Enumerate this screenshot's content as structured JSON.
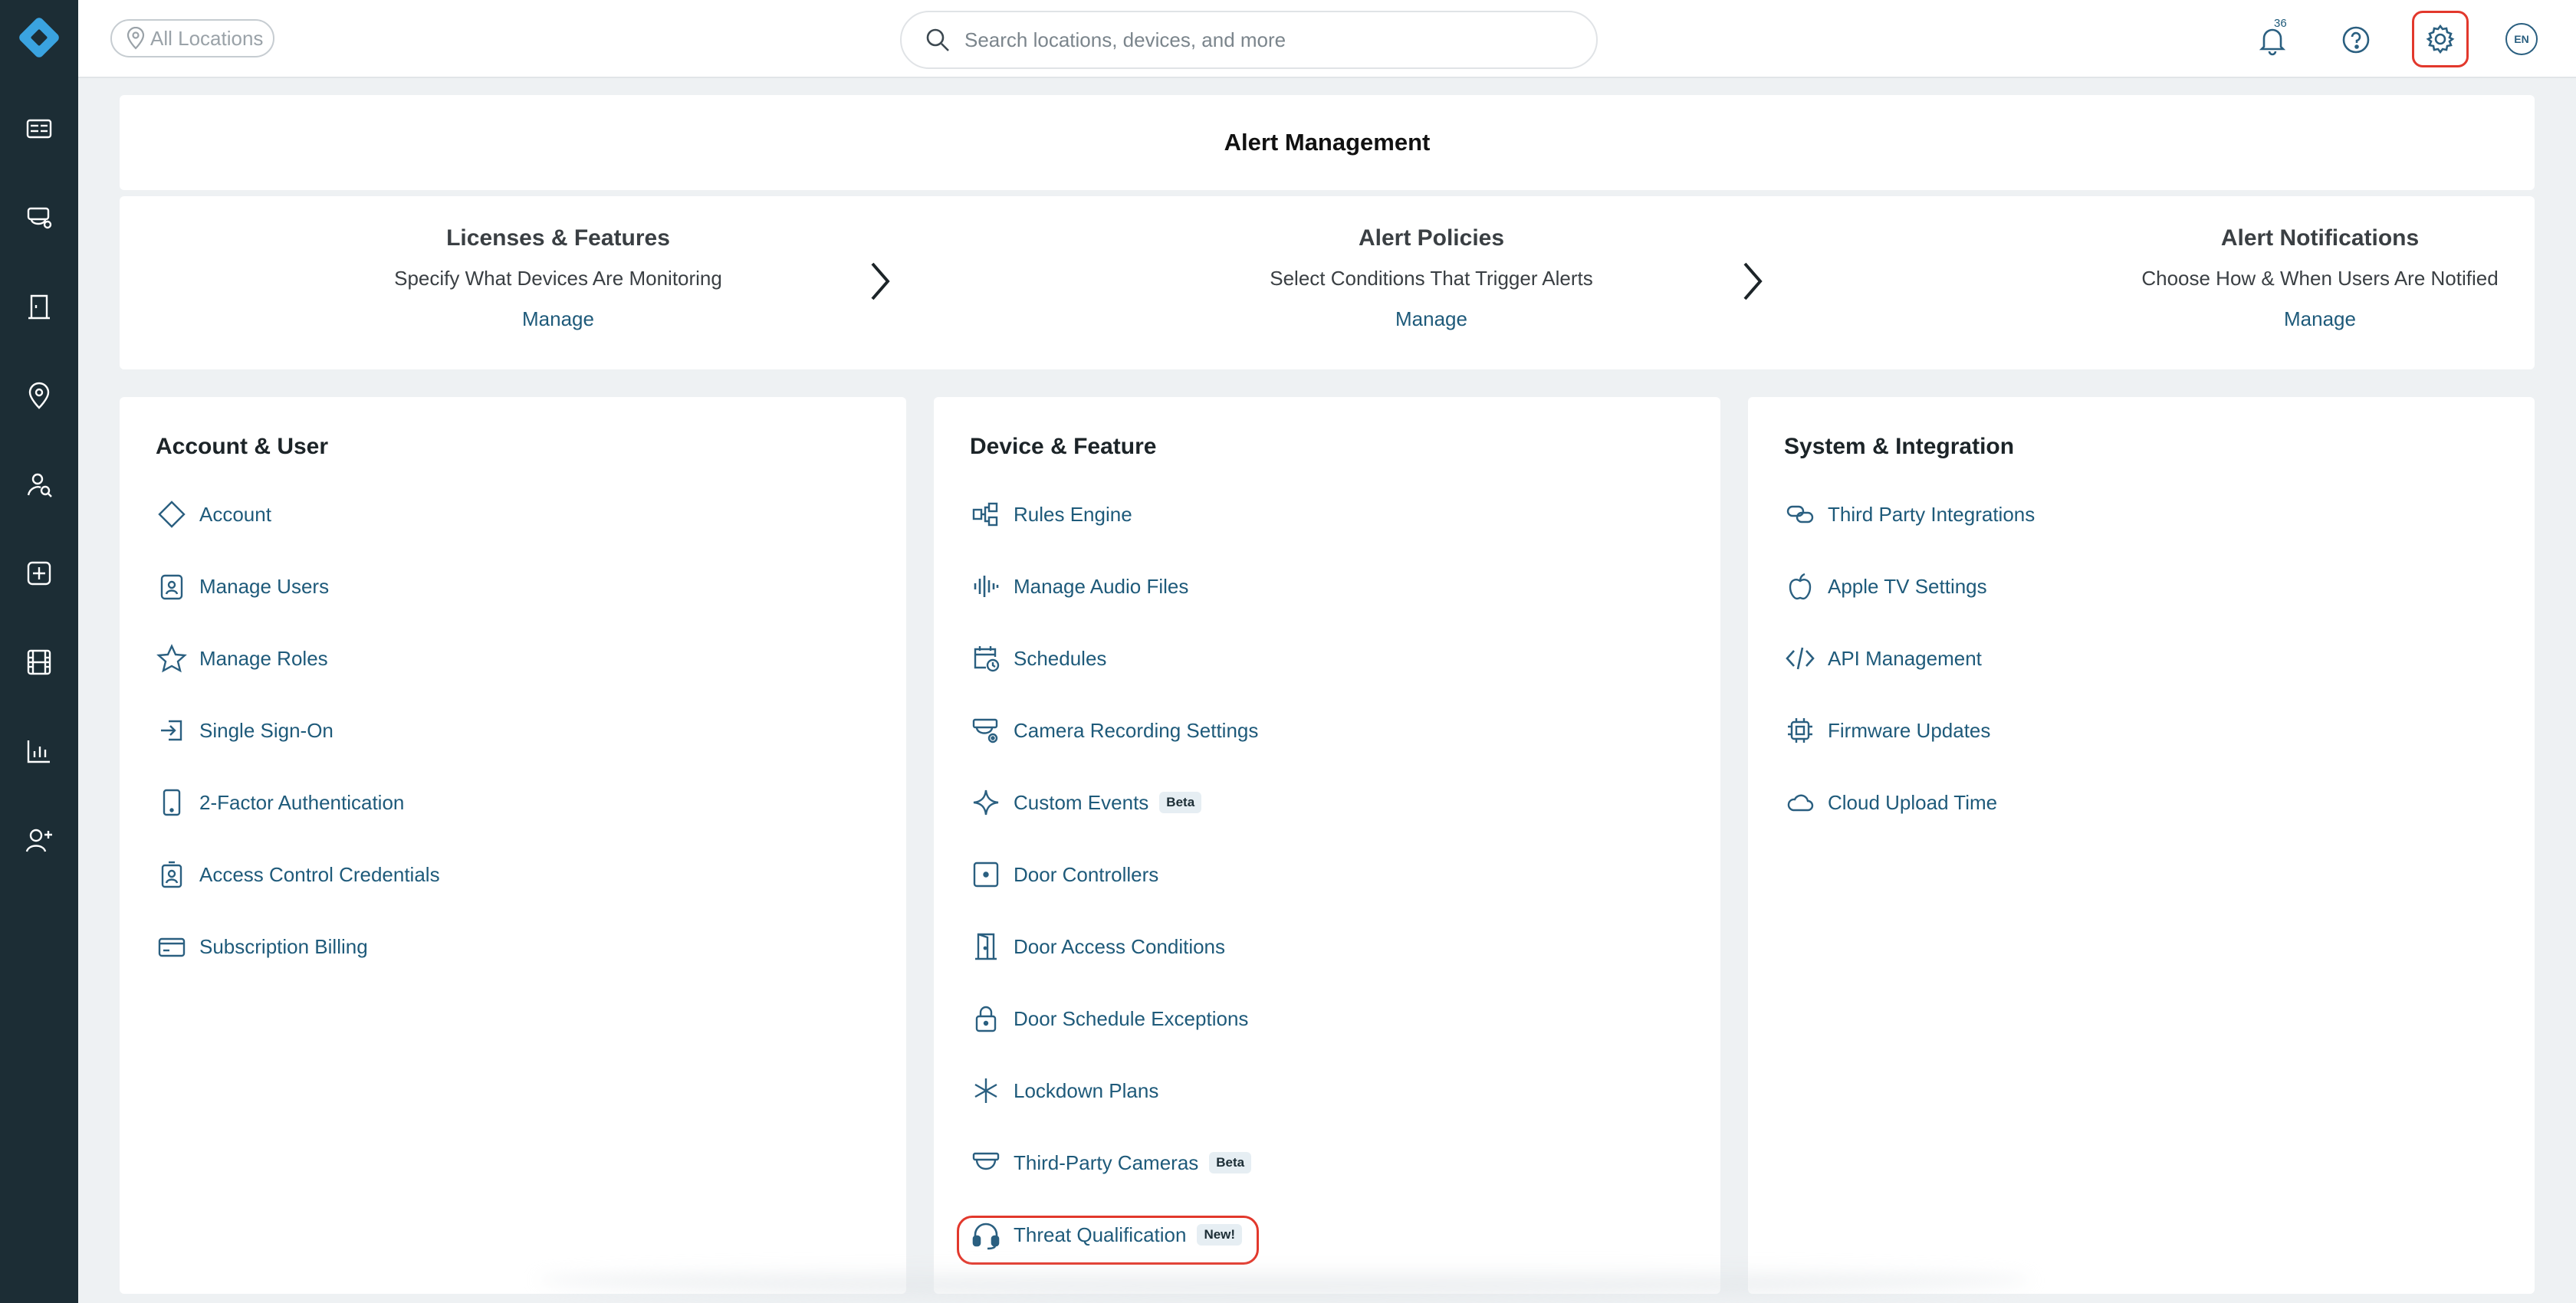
{
  "topbar": {
    "location_label": "All Locations",
    "search_placeholder": "Search locations, devices, and more",
    "notification_count": "36",
    "language": "EN"
  },
  "leftnav": {
    "items": [
      "dashboard-icon",
      "cameras-icon",
      "access-door-icon",
      "location-pin-icon",
      "people-search-icon",
      "add-device-icon",
      "film-icon",
      "analytics-chart-icon",
      "add-user-icon"
    ]
  },
  "alert_management": {
    "title": "Alert Management",
    "steps": [
      {
        "title": "Licenses & Features",
        "desc": "Specify What Devices Are Monitoring",
        "action": "Manage"
      },
      {
        "title": "Alert Policies",
        "desc": "Select Conditions That Trigger Alerts",
        "action": "Manage"
      },
      {
        "title": "Alert Notifications",
        "desc": "Choose How & When Users Are Notified",
        "action": "Manage"
      }
    ]
  },
  "account_user": {
    "title": "Account & User",
    "items": [
      {
        "label": "Account",
        "icon": "diamond-icon"
      },
      {
        "label": "Manage Users",
        "icon": "user-badge-icon"
      },
      {
        "label": "Manage Roles",
        "icon": "star-icon"
      },
      {
        "label": "Single Sign-On",
        "icon": "sign-in-icon"
      },
      {
        "label": "2-Factor Authentication",
        "icon": "phone-icon"
      },
      {
        "label": "Access Control Credentials",
        "icon": "credential-badge-icon"
      },
      {
        "label": "Subscription Billing",
        "icon": "credit-card-icon"
      }
    ]
  },
  "device_feature": {
    "title": "Device & Feature",
    "items": [
      {
        "label": "Rules Engine",
        "icon": "rules-flow-icon"
      },
      {
        "label": "Manage Audio Files",
        "icon": "audio-wave-icon"
      },
      {
        "label": "Schedules",
        "icon": "calendar-clock-icon"
      },
      {
        "label": "Camera Recording Settings",
        "icon": "camera-settings-icon"
      },
      {
        "label": "Custom Events",
        "icon": "sparkle-icon",
        "tag": "Beta"
      },
      {
        "label": "Door Controllers",
        "icon": "door-controller-icon"
      },
      {
        "label": "Door Access Conditions",
        "icon": "door-icon"
      },
      {
        "label": "Door Schedule Exceptions",
        "icon": "lock-icon"
      },
      {
        "label": "Lockdown Plans",
        "icon": "asterisk-icon"
      },
      {
        "label": "Third-Party Cameras",
        "icon": "dome-camera-icon",
        "tag": "Beta"
      },
      {
        "label": "Threat Qualification",
        "icon": "headset-icon",
        "tag": "New!"
      }
    ]
  },
  "system_integration": {
    "title": "System & Integration",
    "items": [
      {
        "label": "Third Party Integrations",
        "icon": "link-icon"
      },
      {
        "label": "Apple TV Settings",
        "icon": "apple-icon"
      },
      {
        "label": "API Management",
        "icon": "code-icon"
      },
      {
        "label": "Firmware Updates",
        "icon": "chip-icon"
      },
      {
        "label": "Cloud Upload Time",
        "icon": "cloud-icon"
      }
    ]
  }
}
